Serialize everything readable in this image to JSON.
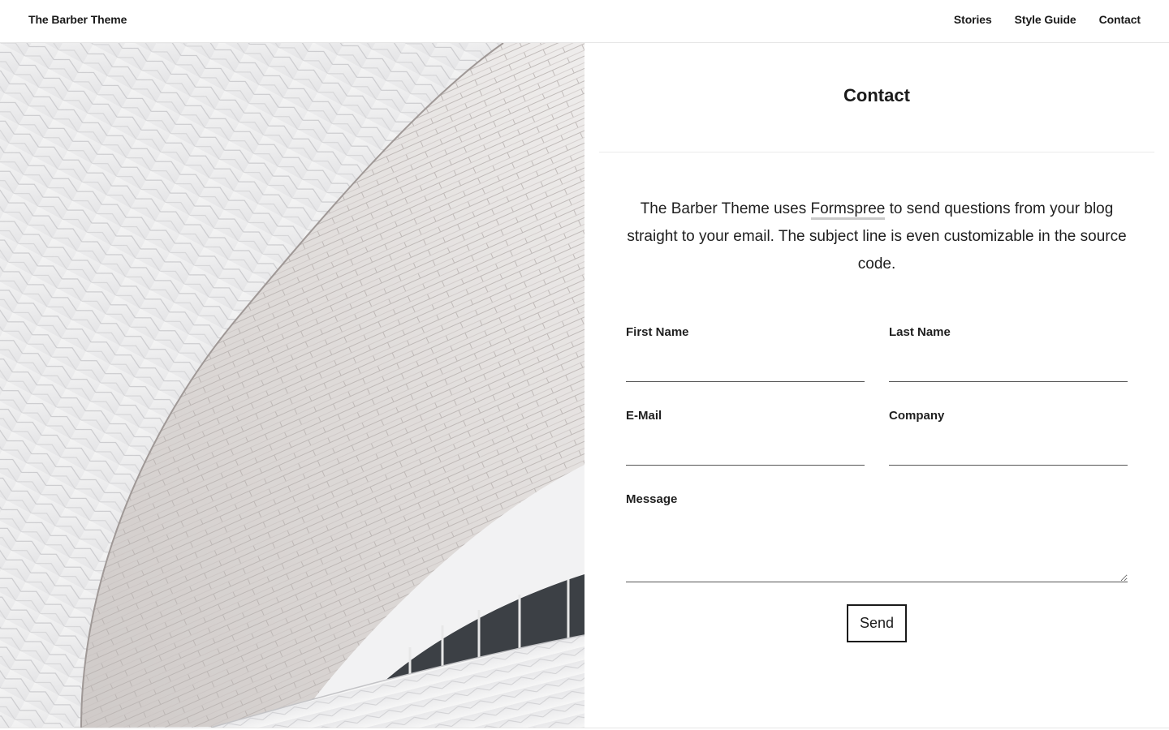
{
  "header": {
    "brand": "The Barber Theme",
    "nav": [
      "Stories",
      "Style Guide",
      "Contact"
    ]
  },
  "page": {
    "title": "Contact",
    "intro_before": "The Barber Theme uses ",
    "intro_link": "Formspree",
    "intro_after": " to send questions from your blog straight to your email. The subject line is even customizable in the source code."
  },
  "form": {
    "first_name_label": "First Name",
    "last_name_label": "Last Name",
    "email_label": "E-Mail",
    "company_label": "Company",
    "message_label": "Message",
    "first_name_value": "",
    "last_name_value": "",
    "email_value": "",
    "company_value": "",
    "message_value": "",
    "send_label": "Send"
  },
  "colors": {
    "text": "#1f1f1f",
    "border": "#555555",
    "link_underline": "#c9c9c9"
  }
}
